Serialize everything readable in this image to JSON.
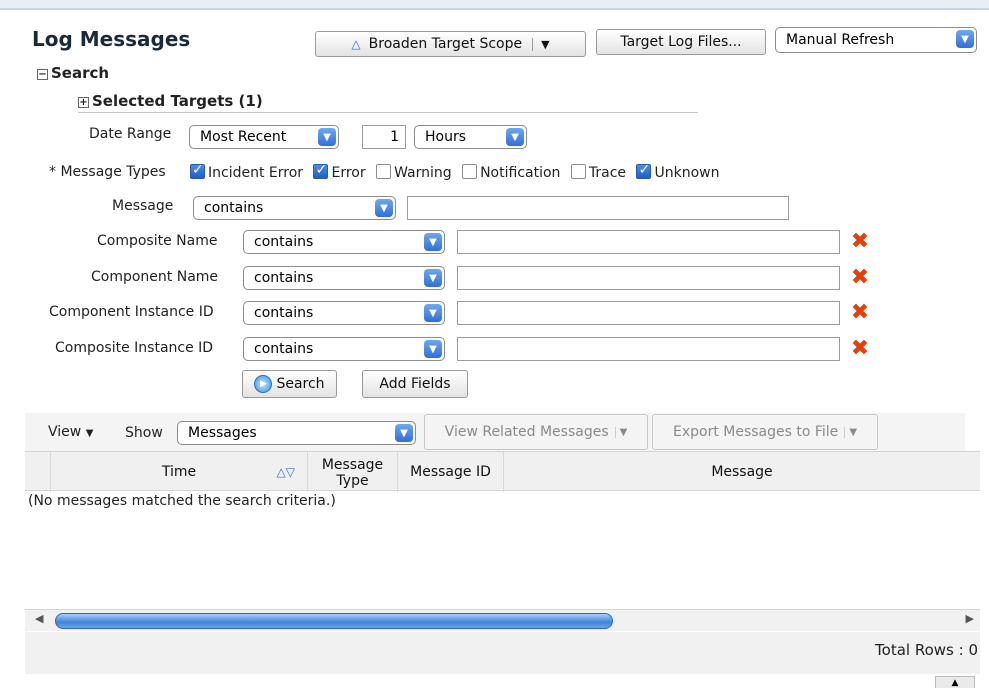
{
  "header": {
    "title": "Log Messages",
    "broaden_label": "Broaden Target Scope",
    "target_log_label": "Target Log Files...",
    "refresh_label": "Manual Refresh"
  },
  "search": {
    "section_label": "Search",
    "selected_targets_label": "Selected Targets (1)",
    "date_range_label": "Date Range",
    "date_range_value": "Most Recent",
    "count_value": "1",
    "unit_value": "Hours",
    "message_types_label": "* Message Types",
    "message_types": [
      {
        "label": "Incident Error",
        "checked": true
      },
      {
        "label": "Error",
        "checked": true
      },
      {
        "label": "Warning",
        "checked": false
      },
      {
        "label": "Notification",
        "checked": false
      },
      {
        "label": "Trace",
        "checked": false
      },
      {
        "label": "Unknown",
        "checked": true
      }
    ],
    "message_label": "Message",
    "message_op": "contains",
    "fields": [
      {
        "label": "Composite Name",
        "op": "contains"
      },
      {
        "label": "Component Name",
        "op": "contains"
      },
      {
        "label": "Component Instance ID",
        "op": "contains"
      },
      {
        "label": "Composite Instance ID",
        "op": "contains"
      }
    ],
    "search_btn": "Search",
    "add_fields_btn": "Add Fields"
  },
  "results": {
    "view_label": "View",
    "show_label": "Show",
    "show_value": "Messages",
    "related_btn": "View Related Messages",
    "export_btn": "Export Messages to File",
    "columns": [
      "Time",
      "Message Type",
      "Message ID",
      "Message"
    ],
    "empty_text": "(No messages matched the search criteria.)",
    "total_rows": "Total Rows : 0"
  }
}
